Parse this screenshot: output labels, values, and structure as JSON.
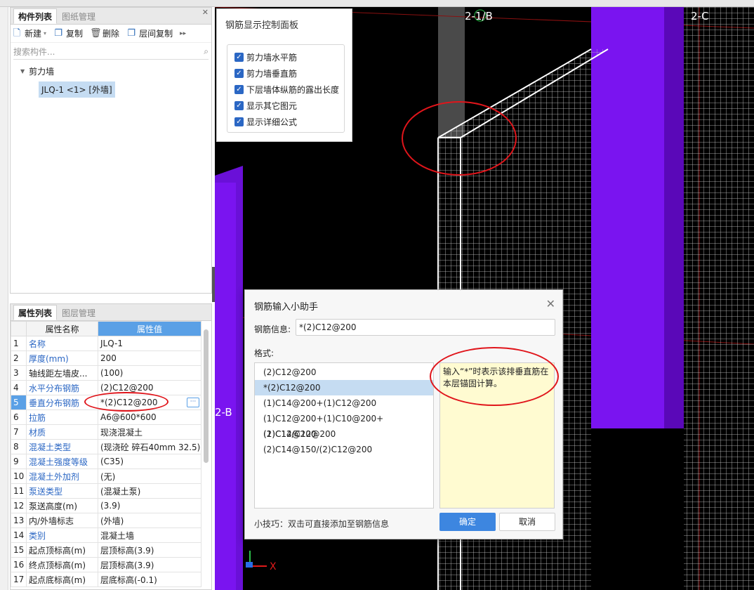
{
  "component_panel": {
    "tabs": [
      "构件列表",
      "图纸管理"
    ],
    "toolbar": {
      "new": "新建",
      "copy": "复制",
      "delete": "删除",
      "floor_copy": "层间复制"
    },
    "search_placeholder": "搜索构件...",
    "tree": {
      "category": "剪力墙",
      "item": "JLQ-1 <1> [外墙]"
    }
  },
  "property_panel": {
    "tabs": [
      "属性列表",
      "图层管理"
    ],
    "headers": {
      "name": "属性名称",
      "value": "属性值"
    },
    "rows": [
      {
        "n": "1",
        "name": "名称",
        "value": "JLQ-1",
        "blue": true
      },
      {
        "n": "2",
        "name": "厚度(mm)",
        "value": "200",
        "blue": true
      },
      {
        "n": "3",
        "name": "轴线距左墙皮...",
        "value": "(100)",
        "blue": false
      },
      {
        "n": "4",
        "name": "水平分布钢筋",
        "value": "(2)C12@200",
        "blue": true
      },
      {
        "n": "5",
        "name": "垂直分布钢筋",
        "value": "*(2)C12@200",
        "blue": true
      },
      {
        "n": "6",
        "name": "拉筋",
        "value": "A6@600*600",
        "blue": true
      },
      {
        "n": "7",
        "name": "材质",
        "value": "现浇混凝土",
        "blue": true
      },
      {
        "n": "8",
        "name": "混凝土类型",
        "value": "(现浇砼 碎石40mm 32.5)",
        "blue": true
      },
      {
        "n": "9",
        "name": "混凝土强度等级",
        "value": "(C35)",
        "blue": true
      },
      {
        "n": "10",
        "name": "混凝土外加剂",
        "value": "(无)",
        "blue": true
      },
      {
        "n": "11",
        "name": "泵送类型",
        "value": "(混凝土泵)",
        "blue": true
      },
      {
        "n": "12",
        "name": "泵送高度(m)",
        "value": "(3.9)",
        "blue": false
      },
      {
        "n": "13",
        "name": "内/外墙标志",
        "value": "(外墙)",
        "blue": false
      },
      {
        "n": "14",
        "name": "类别",
        "value": "混凝土墙",
        "blue": true
      },
      {
        "n": "15",
        "name": "起点顶标高(m)",
        "value": "层顶标高(3.9)",
        "blue": false
      },
      {
        "n": "16",
        "name": "终点顶标高(m)",
        "value": "层顶标高(3.9)",
        "blue": false
      },
      {
        "n": "17",
        "name": "起点底标高(m)",
        "value": "层底标高(-0.1)",
        "blue": false
      }
    ],
    "selected_row": "5"
  },
  "control_panel": {
    "title": "钢筋显示控制面板",
    "options": [
      "剪力墙水平筋",
      "剪力墙垂直筋",
      "下层墙体纵筋的露出长度",
      "显示其它图元",
      "显示详细公式"
    ]
  },
  "viewport": {
    "axis_labels": [
      "2-1/B",
      "2-C",
      "2-B"
    ],
    "axis_x": "X"
  },
  "dialog": {
    "title": "钢筋输入小助手",
    "info_label": "钢筋信息:",
    "info_value": "*(2)C12@200",
    "format_label": "格式:",
    "formats": [
      "(2)C12@200",
      "*(2)C12@200",
      "(1)C14@200+(1)C12@200",
      "(1)C12@200+(1)C10@200+(1)C12@200",
      "(2)C14/C12@200",
      "(2)C14@150/(2)C12@200"
    ],
    "selected_format": 1,
    "hint": "输入“*”时表示该排垂直筋在本层锚固计算。",
    "tip": "小技巧：双击可直接添加至钢筋信息",
    "ok": "确定",
    "cancel": "取消"
  },
  "colors": {
    "accent": "#3d86e0",
    "wall": "#7a14f0",
    "annotation": "#e0151b",
    "hint_bg": "#fffbd1"
  }
}
